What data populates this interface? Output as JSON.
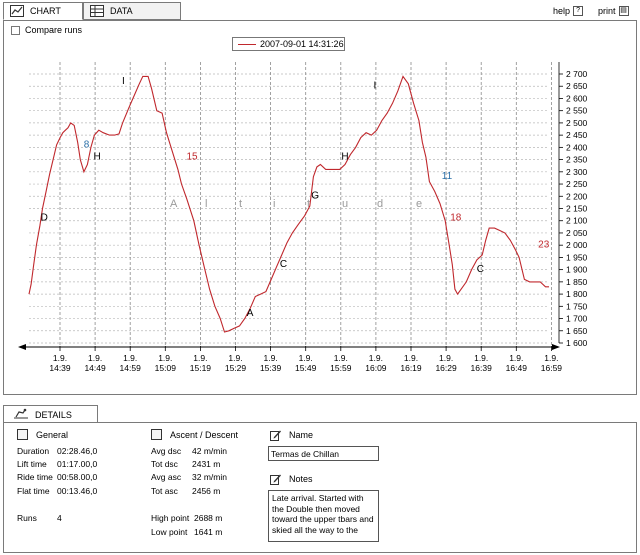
{
  "tabs": [
    {
      "label": "CHART",
      "icon": "chart-icon"
    },
    {
      "label": "DATA",
      "icon": "table-icon"
    }
  ],
  "toolbar": {
    "help_label": "help",
    "print_label": "print"
  },
  "compare_runs_label": "Compare runs",
  "chart_data": {
    "type": "line",
    "series": [
      {
        "name": "2007-09-01 14:31:26",
        "color": "#c0282d"
      }
    ],
    "x_labels": [
      "14:39",
      "14:49",
      "14:59",
      "15:09",
      "15:19",
      "15:29",
      "15:39",
      "15:49",
      "15:59",
      "16:09",
      "16:19",
      "16:29",
      "16:39",
      "16:49",
      "16:59"
    ],
    "x_date_label": "1.9.",
    "y_ticks": [
      1600,
      1650,
      1700,
      1750,
      1800,
      1850,
      1900,
      1950,
      2000,
      2050,
      2100,
      2150,
      2200,
      2250,
      2300,
      2350,
      2400,
      2450,
      2500,
      2550,
      2600,
      2650,
      2700
    ],
    "ylim": [
      1600,
      2740
    ],
    "grid": true,
    "watermark": [
      "A",
      "l",
      "t",
      "i",
      "t",
      "u",
      "d",
      "e"
    ],
    "points": [
      [
        14.63,
        1800
      ],
      [
        14.75,
        1840
      ],
      [
        14.9,
        1920
      ],
      [
        15.05,
        2000
      ],
      [
        15.25,
        2080
      ],
      [
        15.4,
        2150
      ],
      [
        15.6,
        2220
      ],
      [
        15.8,
        2290
      ],
      [
        16.0,
        2350
      ],
      [
        16.2,
        2410
      ],
      [
        16.4,
        2440
      ],
      [
        16.55,
        2460
      ],
      [
        16.7,
        2470
      ],
      [
        16.85,
        2480
      ],
      [
        17.0,
        2500
      ],
      [
        17.2,
        2490
      ],
      [
        17.4,
        2420
      ],
      [
        17.55,
        2350
      ],
      [
        17.75,
        2300
      ],
      [
        17.95,
        2330
      ],
      [
        18.15,
        2400
      ],
      [
        18.35,
        2450
      ],
      [
        18.6,
        2470
      ],
      [
        18.85,
        2460
      ],
      [
        19.2,
        2450
      ],
      [
        19.5,
        2450
      ],
      [
        19.75,
        2455
      ],
      [
        19.95,
        2500
      ],
      [
        20.3,
        2560
      ],
      [
        20.6,
        2610
      ],
      [
        20.9,
        2660
      ],
      [
        21.1,
        2690
      ],
      [
        21.4,
        2690
      ],
      [
        21.6,
        2640
      ],
      [
        21.9,
        2550
      ],
      [
        22.2,
        2540
      ],
      [
        22.45,
        2460
      ],
      [
        22.75,
        2390
      ],
      [
        23.1,
        2310
      ],
      [
        23.3,
        2250
      ],
      [
        23.6,
        2190
      ],
      [
        24.0,
        2100
      ],
      [
        24.3,
        2000
      ],
      [
        24.6,
        1910
      ],
      [
        24.9,
        1820
      ],
      [
        25.2,
        1750
      ],
      [
        25.5,
        1700
      ],
      [
        25.75,
        1645
      ],
      [
        26.0,
        1650
      ],
      [
        26.3,
        1660
      ],
      [
        26.6,
        1670
      ],
      [
        26.9,
        1700
      ],
      [
        27.2,
        1740
      ],
      [
        27.5,
        1790
      ],
      [
        27.8,
        1800
      ],
      [
        28.1,
        1810
      ],
      [
        28.4,
        1860
      ],
      [
        28.7,
        1910
      ],
      [
        29.0,
        1960
      ],
      [
        29.3,
        2010
      ],
      [
        29.6,
        2050
      ],
      [
        29.9,
        2080
      ],
      [
        30.1,
        2100
      ],
      [
        30.3,
        2120
      ],
      [
        30.6,
        2160
      ],
      [
        30.8,
        2280
      ],
      [
        31.0,
        2320
      ],
      [
        31.2,
        2330
      ],
      [
        31.5,
        2310
      ],
      [
        31.9,
        2310
      ],
      [
        32.3,
        2310
      ],
      [
        32.6,
        2330
      ],
      [
        32.9,
        2370
      ],
      [
        33.2,
        2400
      ],
      [
        33.5,
        2440
      ],
      [
        33.8,
        2460
      ],
      [
        34.1,
        2450
      ],
      [
        34.4,
        2470
      ],
      [
        34.7,
        2510
      ],
      [
        35.0,
        2540
      ],
      [
        35.3,
        2580
      ],
      [
        35.6,
        2630
      ],
      [
        35.9,
        2690
      ],
      [
        36.2,
        2660
      ],
      [
        36.5,
        2580
      ],
      [
        36.8,
        2510
      ],
      [
        37.0,
        2420
      ],
      [
        37.2,
        2360
      ],
      [
        37.4,
        2260
      ],
      [
        37.7,
        2220
      ],
      [
        38.0,
        2170
      ],
      [
        38.3,
        2100
      ],
      [
        38.5,
        2010
      ],
      [
        38.7,
        1920
      ],
      [
        38.85,
        1820
      ],
      [
        39.0,
        1800
      ],
      [
        39.2,
        1820
      ],
      [
        39.5,
        1850
      ],
      [
        39.8,
        1900
      ],
      [
        40.1,
        1940
      ],
      [
        40.4,
        1960
      ],
      [
        40.6,
        2020
      ],
      [
        40.8,
        2070
      ],
      [
        41.1,
        2070
      ],
      [
        41.4,
        2060
      ],
      [
        41.7,
        2050
      ],
      [
        42.0,
        2020
      ],
      [
        42.3,
        1980
      ],
      [
        42.5,
        1950
      ],
      [
        42.8,
        1860
      ],
      [
        43.1,
        1850
      ],
      [
        43.4,
        1850
      ],
      [
        43.7,
        1850
      ],
      [
        44.0,
        1830
      ],
      [
        44.2,
        1830
      ]
    ],
    "annotations": [
      {
        "text": "D",
        "x": 15.5,
        "y": 2100,
        "color": "#000"
      },
      {
        "text": "8",
        "x": 17.9,
        "y": 2400,
        "color": "#2a6fa8"
      },
      {
        "text": "H",
        "x": 18.5,
        "y": 2350,
        "color": "#000"
      },
      {
        "text": "I",
        "x": 20.0,
        "y": 2660,
        "color": "#000"
      },
      {
        "text": "15",
        "x": 23.9,
        "y": 2350,
        "color": "#c0282d"
      },
      {
        "text": "A",
        "x": 27.2,
        "y": 1710,
        "color": "#000"
      },
      {
        "text": "C",
        "x": 29.1,
        "y": 1910,
        "color": "#000"
      },
      {
        "text": "G",
        "x": 30.9,
        "y": 2190,
        "color": "#000"
      },
      {
        "text": "H",
        "x": 32.6,
        "y": 2350,
        "color": "#000"
      },
      {
        "text": "I",
        "x": 34.3,
        "y": 2640,
        "color": "#000"
      },
      {
        "text": "11",
        "x": 38.4,
        "y": 2270,
        "color": "#2a6fa8"
      },
      {
        "text": "18",
        "x": 38.9,
        "y": 2100,
        "color": "#c0282d"
      },
      {
        "text": "C",
        "x": 40.3,
        "y": 1890,
        "color": "#000"
      },
      {
        "text": "23",
        "x": 43.9,
        "y": 1990,
        "color": "#c0282d"
      }
    ]
  },
  "details": {
    "tab_label": "DETAILS",
    "general": {
      "title": "General",
      "rows": [
        {
          "label": "Duration",
          "value": "02:28.46,0"
        },
        {
          "label": "Lift time",
          "value": "01:17.00,0"
        },
        {
          "label": "Ride time",
          "value": "00:58.00,0"
        },
        {
          "label": "Flat time",
          "value": "00:13.46,0"
        }
      ],
      "runs_label": "Runs",
      "runs_value": "4"
    },
    "ascent": {
      "title": "Ascent / Descent",
      "rows": [
        {
          "label": "Avg dsc",
          "value": "42 m/min"
        },
        {
          "label": "Tot dsc",
          "value": "2431 m"
        },
        {
          "label": "Avg asc",
          "value": "32 m/min"
        },
        {
          "label": "Tot asc",
          "value": "2456 m"
        }
      ],
      "high_label": "High point",
      "high_value": "2688 m",
      "low_label": "Low point",
      "low_value": "1641 m"
    },
    "name": {
      "title": "Name",
      "value": "Termas de Chillan"
    },
    "notes": {
      "title": "Notes",
      "value": "Late arrival. Started with the Double then moved toward the upper tbars and skied all the way to the"
    }
  }
}
